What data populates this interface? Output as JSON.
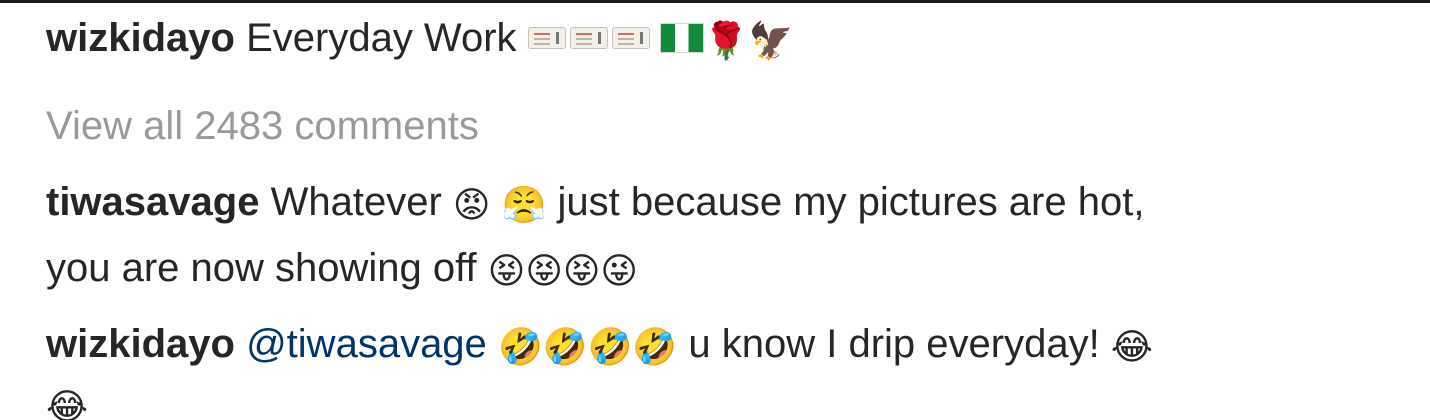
{
  "caption": {
    "username": "wizkidayo",
    "text": "Everyday Work",
    "emoji_icons": [
      "ticket-icon",
      "ticket-icon",
      "ticket-icon",
      "nigeria-flag-icon",
      "rose-icon",
      "eagle-icon"
    ]
  },
  "view_all": {
    "label": "View all 2483 comments"
  },
  "comments": [
    {
      "username": "tiwasavage",
      "text_line1": "Whatever",
      "text_line1_after": "just because my pictures are hot,",
      "text_line2": "you are now showing off",
      "emoji_icons": [
        "angry-face-icon",
        "steam-face-icon",
        "squinting-tongue-face-icon",
        "squinting-tongue-face-icon",
        "squinting-tongue-face-icon",
        "winking-tongue-face-icon"
      ]
    },
    {
      "username": "wizkidayo",
      "mention": "@tiwasavage",
      "text": "u know I drip everyday!",
      "emoji_icons": [
        "rolling-laughing-icon",
        "rolling-laughing-icon",
        "rolling-laughing-icon",
        "rolling-laughing-icon",
        "tears-of-joy-icon",
        "tears-of-joy-icon"
      ]
    }
  ]
}
